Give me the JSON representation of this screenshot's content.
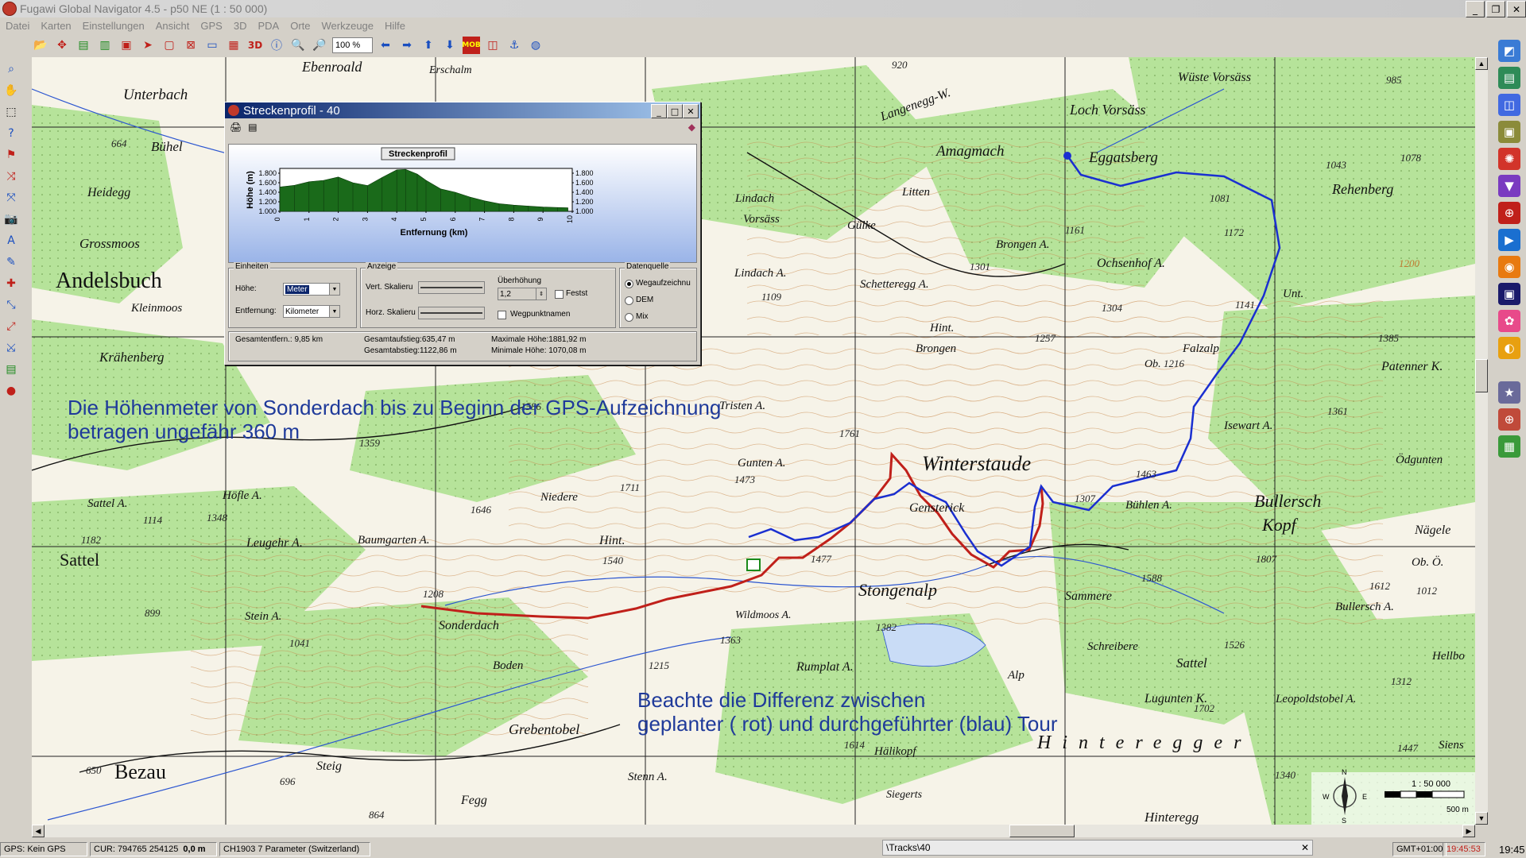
{
  "app": {
    "title": "Fugawi Global Navigator 4.5 - p50 NE  (1 : 50 000)",
    "window_buttons": [
      "_",
      "❐",
      "✕"
    ]
  },
  "menu": [
    "Datei",
    "Karten",
    "Einstellungen",
    "Ansicht",
    "GPS",
    "3D",
    "PDA",
    "Orte",
    "Werkzeuge",
    "Hilfe"
  ],
  "toolbar": {
    "zoom": "100 %",
    "mob_label": "MOB",
    "threed_label": "3D"
  },
  "map": {
    "annotation1": [
      "Die Höhenmeter von Sonderdach bis zu Beginn der GPS-Aufzeichnung",
      "betragen ungefähr 360 m"
    ],
    "annotation2": [
      "Beachte die Differenz zwischen",
      "geplanter ( rot) und durchgeführter (blau) Tour"
    ],
    "place_labels": [
      {
        "t": "Ebenroald"
      },
      {
        "t": "Erschalm"
      },
      {
        "t": "Unterbach"
      },
      {
        "t": "Bühel"
      },
      {
        "t": "Heidegg"
      },
      {
        "t": "Grossmoos"
      },
      {
        "t": "Andelsbuch"
      },
      {
        "t": "Kleinmoos"
      },
      {
        "t": "Krähenberg"
      },
      {
        "t": "Sattel A."
      },
      {
        "t": "Höfle A."
      },
      {
        "t": "Sattel"
      },
      {
        "t": "Leugehr A."
      },
      {
        "t": "Baumgarten A."
      },
      {
        "t": "Stein A."
      },
      {
        "t": "Sonderdach"
      },
      {
        "t": "Boden"
      },
      {
        "t": "Grebentobel"
      },
      {
        "t": "Bezau"
      },
      {
        "t": "Steig"
      },
      {
        "t": "Fegg"
      },
      {
        "t": "Stenn A."
      },
      {
        "t": "Hälikopf"
      },
      {
        "t": "Siegerts"
      },
      {
        "t": "Rumplat A."
      },
      {
        "t": "Wildmoos A."
      },
      {
        "t": "Hint."
      },
      {
        "t": "Niedere"
      },
      {
        "t": "Gunten A."
      },
      {
        "t": "Tristen A."
      },
      {
        "t": "Winterstaude"
      },
      {
        "t": "Stongenalp"
      },
      {
        "t": "Sammere"
      },
      {
        "t": "Schreibere"
      },
      {
        "t": "Alp"
      },
      {
        "t": "Sattel"
      },
      {
        "t": "Lugunten K."
      },
      {
        "t": "Leopoldstobel A."
      },
      {
        "t": "Hinteregger"
      },
      {
        "t": "Hinteregg"
      },
      {
        "t": "Bühlen A."
      },
      {
        "t": "Bullersch"
      },
      {
        "t": "Kopf"
      },
      {
        "t": "Bullersch A."
      },
      {
        "t": "Isewart A."
      },
      {
        "t": "Patenner K."
      },
      {
        "t": "Falzalp"
      },
      {
        "t": "Unt."
      },
      {
        "t": "Ob."
      },
      {
        "t": "Ochsenhof A."
      },
      {
        "t": "Brongen A."
      },
      {
        "t": "Schetteregg A."
      },
      {
        "t": "Lindach A."
      },
      {
        "t": "Lindach"
      },
      {
        "t": "Vorsäss"
      },
      {
        "t": "Litten"
      },
      {
        "t": "Gülke"
      },
      {
        "t": "Amagmach"
      },
      {
        "t": "Eggatsberg"
      },
      {
        "t": "Rehenberg"
      },
      {
        "t": "Loch Vorsäss"
      },
      {
        "t": "Wüste Vorsäss"
      },
      {
        "t": "Langenegg-W."
      },
      {
        "t": "Hint."
      },
      {
        "t": "Brongen"
      },
      {
        "t": "Ödgunten"
      },
      {
        "t": "Nägele"
      },
      {
        "t": "Ob. Ö."
      },
      {
        "t": "Hellbo"
      },
      {
        "t": "Siens"
      },
      {
        "t": "Gensterick"
      }
    ],
    "heights": [
      "664",
      "920",
      "985",
      "1078",
      "1043",
      "1081",
      "1172",
      "1161",
      "1301",
      "1304",
      "1141",
      "1257",
      "1216",
      "1385",
      "1361",
      "1463",
      "1307",
      "1761",
      "1473",
      "1586",
      "1359",
      "1646",
      "1711",
      "1540",
      "1477",
      "1182",
      "1114",
      "1348",
      "1208",
      "899",
      "1041",
      "1363",
      "1215",
      "1382",
      "1614",
      "1526",
      "1588",
      "1807",
      "1612",
      "1702",
      "1447",
      "1340",
      "1312",
      "650",
      "696",
      "864",
      "1109",
      "1200",
      "1012"
    ],
    "scale": {
      "ratio": "1 : 50 000",
      "bar_label": "500 m",
      "compass": [
        "N",
        "W",
        "E",
        "S"
      ]
    }
  },
  "dialog": {
    "title": "Streckenprofil - 40",
    "chart_title": "Streckenprofil",
    "groups": {
      "einheiten": "Einheiten",
      "anzeige": "Anzeige",
      "datenquelle": "Datenquelle"
    },
    "fields": {
      "hoehe_label": "Höhe:",
      "hoehe_value": "Meter",
      "entfernung_label": "Entfernung:",
      "entfernung_value": "Kilometer",
      "vert_label": "Vert. Skalieru",
      "horz_label": "Horz. Skalieru",
      "ueberhoehung_label": "Überhöhung",
      "ueberhoehung_value": "1,2",
      "fest_label": "Festst",
      "wegpunktnamen_label": "Wegpunktnamen",
      "ds_wegaufz": "Wegaufzeichnu",
      "ds_dem": "DEM",
      "ds_mix": "Mix"
    },
    "stats": {
      "gesamtentf": "Gesamtentfern.:  9,85 km",
      "aufstieg": "Gesamtaufstieg:635,47 m",
      "abstieg": "Gesamtabstieg:1122,86 m",
      "maxh": "Maximale Höhe:1881,92 m",
      "minh": "Minimale Höhe: 1070,08 m"
    }
  },
  "chart_data": {
    "type": "area",
    "title": "Streckenprofil",
    "xlabel": "Entfernung (km)",
    "ylabel": "Höhe (m)",
    "xlim": [
      0,
      10
    ],
    "ylim": [
      1000,
      1900
    ],
    "x_ticks": [
      "0",
      "1",
      "2",
      "3",
      "4",
      "5",
      "6",
      "7",
      "8",
      "9",
      "10"
    ],
    "y_ticks": [
      "1.000",
      "1.200",
      "1.400",
      "1.600",
      "1.800"
    ],
    "x": [
      0,
      0.5,
      1.0,
      1.5,
      2.0,
      2.5,
      3.0,
      3.5,
      4.0,
      4.3,
      4.7,
      5.0,
      5.5,
      6.0,
      6.5,
      7.0,
      7.5,
      8.0,
      8.5,
      9.0,
      9.5,
      9.85
    ],
    "values": [
      1510,
      1545,
      1620,
      1650,
      1720,
      1600,
      1540,
      1710,
      1870,
      1880,
      1780,
      1650,
      1470,
      1400,
      1300,
      1220,
      1160,
      1130,
      1110,
      1090,
      1080,
      1075
    ]
  },
  "statusbar": {
    "gps": "GPS: Kein GPS",
    "cursor": "CUR: 794765  254125",
    "dist": "0,0 m",
    "datum": "CH1903 7 Parameter (Switzerland)",
    "tracks_tab": "\\Tracks\\40",
    "gmt": "GMT+01:00",
    "clock": "19:45:53",
    "tray_time": "19:45"
  }
}
